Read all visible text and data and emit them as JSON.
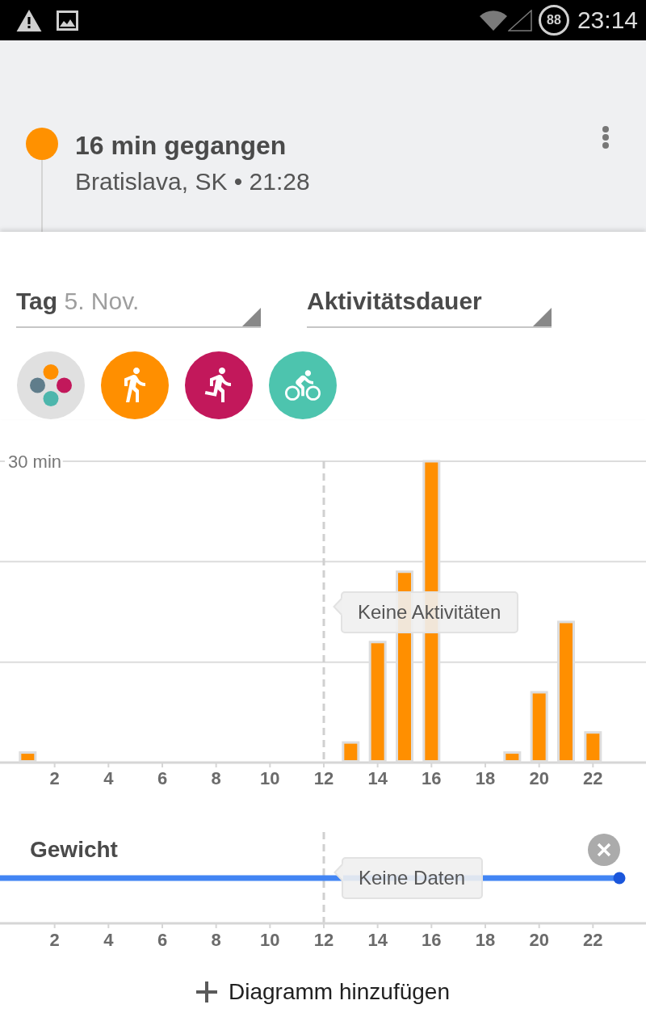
{
  "status_bar": {
    "battery": "88",
    "time": "23:14"
  },
  "timeline_entry": {
    "title": "16 min gegangen",
    "subtitle": "Bratislava, SK • 21:28"
  },
  "selectors": [
    {
      "label": "Tag",
      "value": "5. Nov."
    },
    {
      "label": "Aktivitätsdauer"
    }
  ],
  "activity_filters": [
    {
      "kind": "all",
      "color": "#e0e0e0"
    },
    {
      "kind": "walking",
      "color": "#ff8f00"
    },
    {
      "kind": "running",
      "color": "#c2185b"
    },
    {
      "kind": "cycling",
      "color": "#4dc4ae"
    }
  ],
  "activity_chart": {
    "chart_data": {
      "type": "bar",
      "x": [
        1,
        13,
        14,
        15,
        16,
        19,
        20,
        21,
        22
      ],
      "series": [
        {
          "color": "#ff8f00",
          "values": [
            1,
            2,
            12,
            19,
            30,
            1,
            7,
            14,
            3
          ]
        }
      ],
      "xlim": [
        0,
        24
      ],
      "ylim": [
        0,
        30
      ],
      "xticks": [
        2,
        4,
        6,
        8,
        10,
        12,
        14,
        16,
        18,
        20,
        22
      ],
      "yticks": [
        {
          "value": 30,
          "label": "30 min"
        }
      ],
      "ref_lines": [
        {
          "axis": "y",
          "value": 10
        },
        {
          "axis": "y",
          "value": 20
        }
      ],
      "annotations": [
        "Keine Aktivitäten"
      ]
    }
  },
  "weight_chart": {
    "title": "Gewicht",
    "x_labels": [
      "2",
      "4",
      "6",
      "8",
      "10",
      "12",
      "14",
      "16",
      "18",
      "20",
      "22"
    ],
    "tooltip": "Keine Daten"
  },
  "add_chart_button": {
    "label": "Diagramm hinzufügen"
  }
}
